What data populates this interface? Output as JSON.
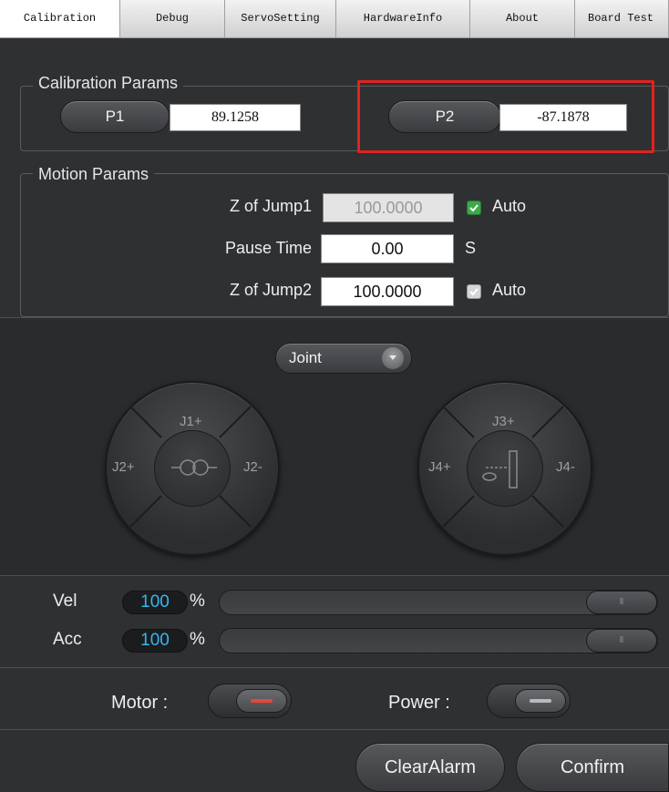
{
  "tabs": [
    "Calibration",
    "Debug",
    "ServoSetting",
    "HardwareInfo",
    "About",
    "Board Test"
  ],
  "calibration": {
    "title": "Calibration Params",
    "p1_label": "P1",
    "p1_value": "89.1258",
    "p2_label": "P2",
    "p2_value": "-87.1878"
  },
  "motion": {
    "title": "Motion Params",
    "z_jump1_label": "Z of Jump1",
    "z_jump1_value": "100.0000",
    "auto1_label": "Auto",
    "pause_label": "Pause Time",
    "pause_value": "0.00",
    "pause_unit": "S",
    "z_jump2_label": "Z of Jump2",
    "z_jump2_value": "100.0000",
    "auto2_label": "Auto"
  },
  "jog": {
    "mode": "Joint",
    "dial_left": {
      "top": "J1+",
      "left": "J2+",
      "right": "J2-"
    },
    "dial_right": {
      "top": "J3+",
      "left": "J4+",
      "right": "J4-"
    }
  },
  "speed": {
    "vel_label": "Vel",
    "vel_value": "100",
    "vel_unit": "%",
    "acc_label": "Acc",
    "acc_value": "100",
    "acc_unit": "%",
    "vel_fraction": 1.0,
    "acc_fraction": 1.0
  },
  "toggles": {
    "motor_label": "Motor :",
    "power_label": "Power :"
  },
  "actions": {
    "clear_alarm": "ClearAlarm",
    "confirm": "Confirm"
  },
  "colors": {
    "accent_blue": "#36b6ef",
    "highlight_red": "#e0231f",
    "motor_bar": "#e5473d",
    "power_bar": "#b8b9bc"
  }
}
